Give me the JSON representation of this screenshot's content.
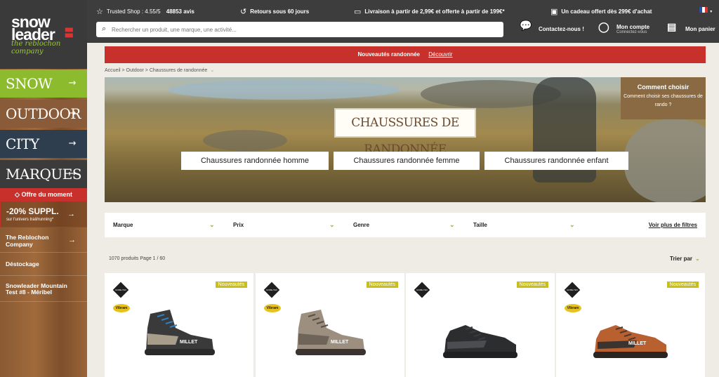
{
  "logo": {
    "line1": "snow",
    "line2": "leader",
    "tagline": "the reblochon company"
  },
  "sidebar": {
    "categories": [
      {
        "label": "Snow"
      },
      {
        "label": "Outdoor"
      },
      {
        "label": "City"
      },
      {
        "label": "Marques"
      }
    ],
    "offre": "Offre du moment",
    "promo": {
      "title": "-20% SUPPL.",
      "subtitle": "sur l'univers trail/running*"
    },
    "items": [
      {
        "label": "The Reblochon Company"
      },
      {
        "label": "Déstockage"
      },
      {
        "label": "Snowleader Mountain Test #8 - Méribel"
      }
    ]
  },
  "topbar": {
    "trusted_label": "Trusted Shop : 4.55/5",
    "trusted_reviews": "48853 avis",
    "retours": "Retours sous 60 jours",
    "livraison": "Livraison à partir de 2,99€ et offerte à partir de 199€*",
    "cadeau": "Un cadeau offert dès 299€ d'achat",
    "search_placeholder": "Rechercher un produit, une marque, une activité...",
    "contact": "Contactez-nous !",
    "account": "Mon compte",
    "account_sub": "Connectez-vous",
    "cart": "Mon panier"
  },
  "promobar": {
    "text": "Nouveautés randonnée",
    "link": "Découvrir"
  },
  "breadcrumb": "Accueil > Outdoor > Chaussures de randonnée",
  "hero": {
    "title": "Chaussures de randonnée",
    "buttons": [
      "Chaussures randonnée homme",
      "Chaussures randonnée femme",
      "Chaussures randonnée enfant"
    ],
    "guide_title": "Comment choisir",
    "guide_text": "Comment choisir ses chaussures de rando ?"
  },
  "filters": {
    "items": [
      "Marque",
      "Prix",
      "Genre",
      "Taille"
    ],
    "more": "Voir plus de filtres"
  },
  "results": {
    "count": "1070 produits Page 1 / 60",
    "sort": "Trier par"
  },
  "products": [
    {
      "badge": "Nouveautés",
      "gtx": "GORE-TEX",
      "vibram": "Vibram",
      "brand": "MILLET",
      "colors": {
        "upper": "#3a3a3a",
        "accent": "#a89c8a",
        "sole": "#2a2a2a",
        "lace": "#2f7fc1"
      }
    },
    {
      "badge": "Nouveautés",
      "gtx": "GORE-TEX",
      "vibram": "Vibram",
      "brand": "MILLET",
      "colors": {
        "upper": "#9c8f80",
        "accent": "#6e6558",
        "sole": "#3a3330",
        "lace": "#5a5048"
      }
    },
    {
      "badge": "Nouveautés",
      "gtx": "GORE-TEX",
      "vibram": "",
      "brand": "",
      "colors": {
        "upper": "#2c2d2f",
        "accent": "#4b4d50",
        "sole": "#202122",
        "lace": "#3a3b3d"
      }
    },
    {
      "badge": "Nouveautés",
      "gtx": "GORE-TEX",
      "vibram": "Vibram",
      "brand": "MILLET",
      "colors": {
        "upper": "#b8602f",
        "accent": "#3a3330",
        "sole": "#2b2522",
        "lace": "#4a3a30"
      }
    }
  ]
}
